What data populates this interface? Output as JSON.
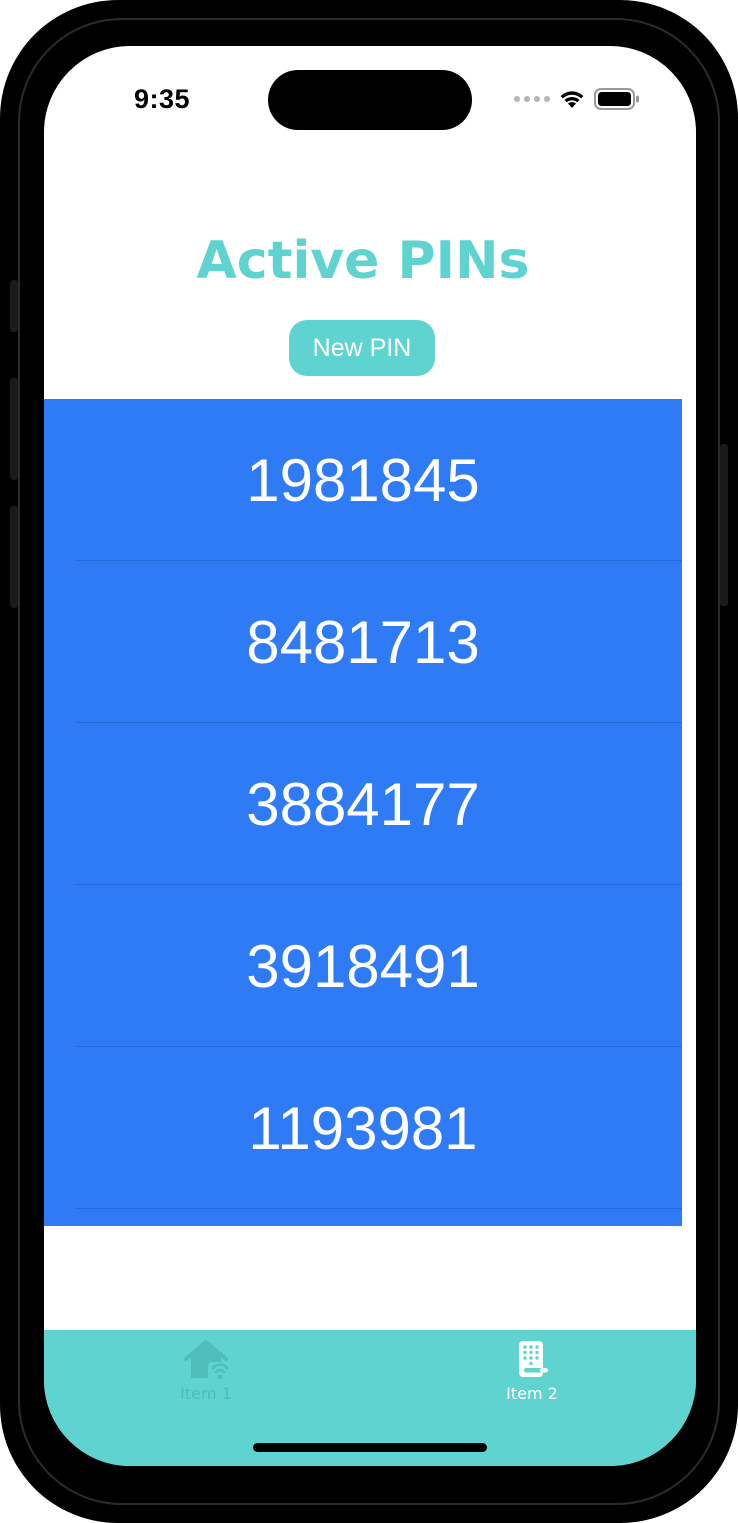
{
  "status_bar": {
    "time": "9:35"
  },
  "header": {
    "title": "Active PINs",
    "new_pin_label": "New PIN"
  },
  "pins": [
    "1981845",
    "8481713",
    "3884177",
    "3918491",
    "1193981"
  ],
  "tab_bar": {
    "items": [
      {
        "label": "Item 1",
        "icon": "home-wifi-icon",
        "selected": false
      },
      {
        "label": "Item 2",
        "icon": "keypad-lock-icon",
        "selected": true
      }
    ]
  },
  "colors": {
    "accent": "#5ed3cf",
    "list_background": "#2f7bf6",
    "tab_inactive": "#4fbdb9",
    "tab_active": "#ffffff"
  }
}
